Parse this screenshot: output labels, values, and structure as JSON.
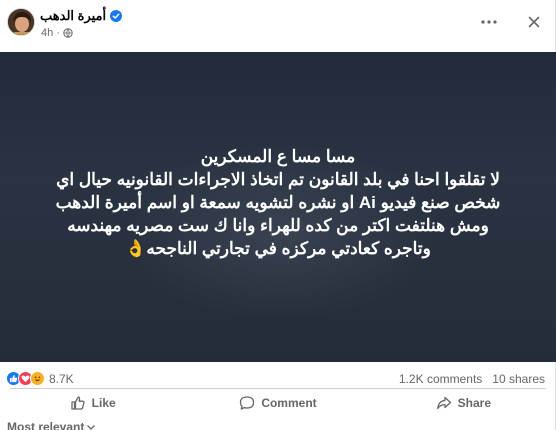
{
  "post": {
    "author": "أميرة الدهب",
    "time": "4h",
    "separator": "·",
    "media_text": [
      "مسا مسا ع المسكرين",
      "لا تقلقوا احنا في بلد القانون تم اتخاذ الاجراءات القانونيه حيال اي",
      "شخص صنع فيديو Ai او نشره لتشويه سمعة او اسم أميرة الدهب",
      "ومش هنلتفت اكتر من كده للهراء وانا ك ست مصريه مهندسه",
      "وتاجره كعادتي مركزه في تجارتي الناجحه👌"
    ]
  },
  "stats": {
    "reaction_count": "8.7K",
    "comments": "1.2K comments",
    "shares": "10 shares",
    "reactions": [
      "like-reaction",
      "love-reaction",
      "haha-reaction"
    ]
  },
  "actions": {
    "like": "Like",
    "comment": "Comment",
    "share": "Share"
  },
  "footer": {
    "sort_label": "Most relevant"
  },
  "colors": {
    "accent": "#1877f2",
    "text_secondary": "#65676b",
    "media_bg": "#252c39"
  }
}
